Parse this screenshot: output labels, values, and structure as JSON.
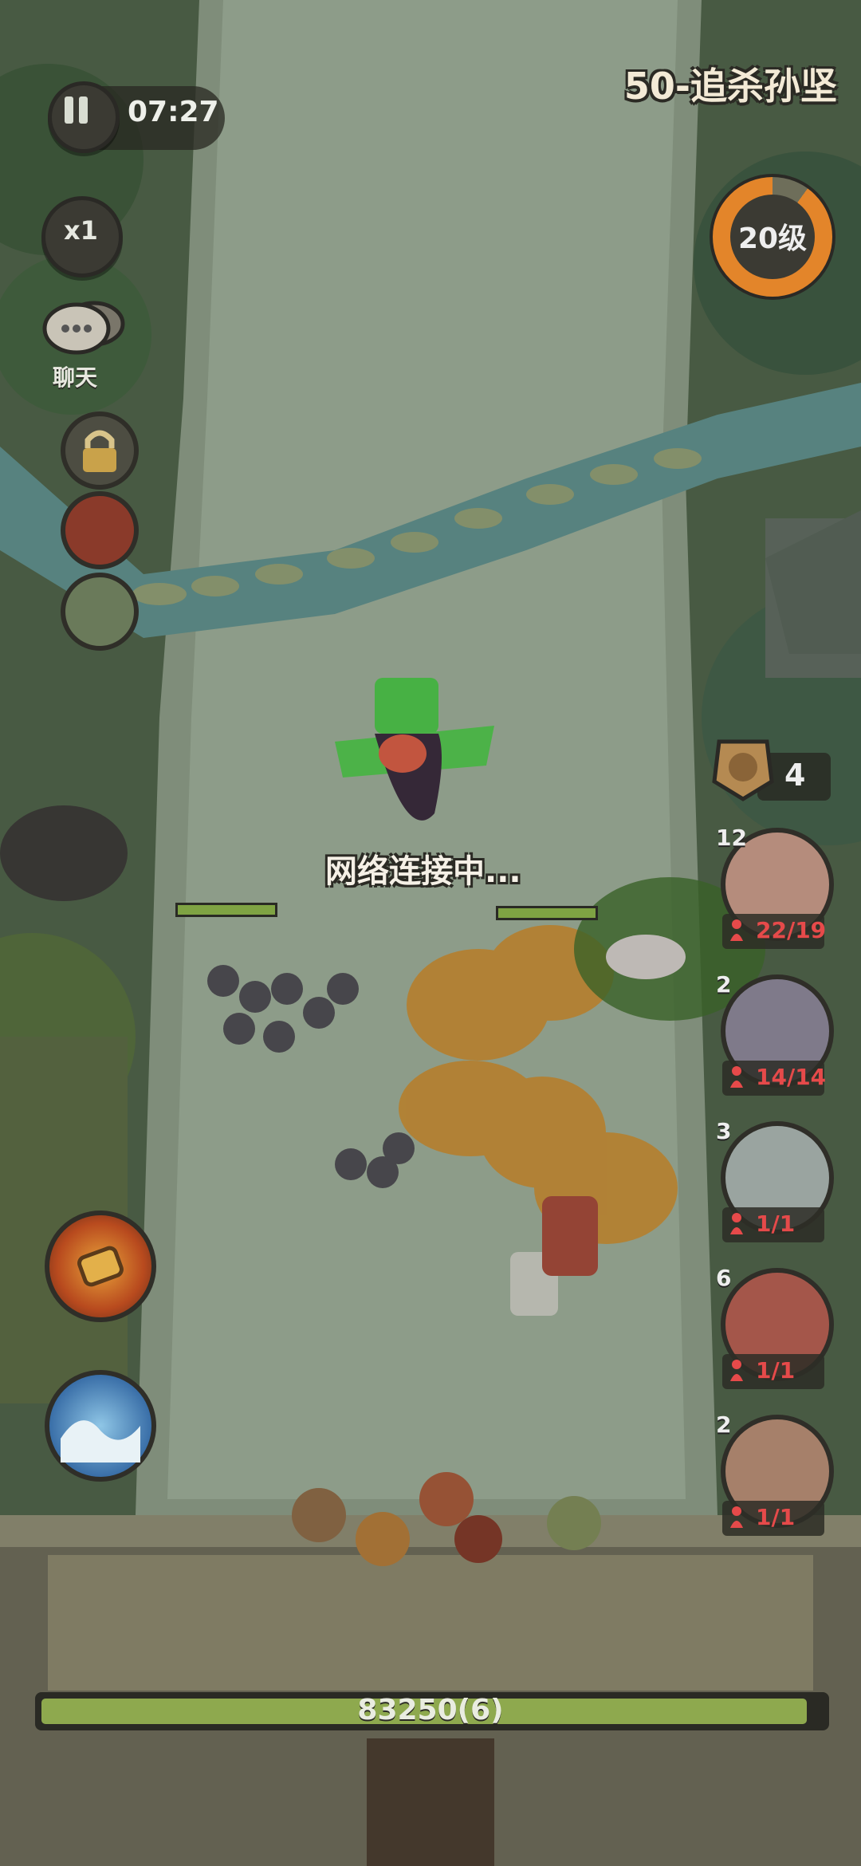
{
  "hud": {
    "timer": "07:27",
    "speed": "x1",
    "chat_label": "聊天",
    "stage_title": "50-追杀孙坚",
    "level": "20级",
    "level_progress": 0.9,
    "token_count": "4",
    "status_text": "网络连接中...",
    "base_hp": "83250(6)",
    "base_hp_fraction": 0.98
  },
  "units": [
    {
      "level": "12",
      "count": "22/19"
    },
    {
      "level": "2",
      "count": "14/14"
    },
    {
      "level": "3",
      "count": "1/1"
    },
    {
      "level": "6",
      "count": "1/1"
    },
    {
      "level": "2",
      "count": "1/1"
    }
  ],
  "icons": {
    "pause": "pause-icon",
    "chat": "chat-bubble-icon",
    "lock": "lock-icon",
    "token": "command-token-icon",
    "person": "person-icon",
    "skill_1": "fire-barrel-skill-icon",
    "skill_2": "wave-skill-icon"
  },
  "colors": {
    "count_red": "#e64a4a",
    "hp_green": "#8ea94e",
    "level_orange": "#e3852a"
  }
}
